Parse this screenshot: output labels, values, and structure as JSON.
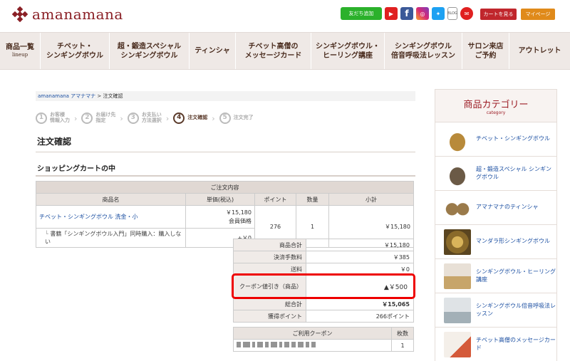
{
  "header": {
    "logo_text": "amanamana",
    "line_label": "友だち追加",
    "blog_label": "BLOG",
    "cart_label": "カートを見る",
    "mypage_label": "マイページ"
  },
  "nav": {
    "items": [
      {
        "label": "商品一覧",
        "sub": "lineup"
      },
      {
        "label": "チベット・",
        "label2": "シンギングボウル"
      },
      {
        "label": "超・鍛造スペシャル",
        "label2": "シンギングボウル"
      },
      {
        "label": "ティンシャ",
        "label2": ""
      },
      {
        "label": "チベット高僧の",
        "label2": "メッセージカード"
      },
      {
        "label": "シンギングボウル・",
        "label2": "ヒーリング講座"
      },
      {
        "label": "シンギングボウル",
        "label2": "倍音呼吸法レッスン"
      },
      {
        "label": "サロン来店",
        "label2": "ご予約"
      },
      {
        "label": "アウトレット",
        "label2": ""
      }
    ]
  },
  "breadcrumb": {
    "link": "amanamana アマナマナ",
    "current": " > 注文確認"
  },
  "steps": [
    {
      "num": "1",
      "line1": "お客様",
      "line2": "情報入力"
    },
    {
      "num": "2",
      "line1": "お届け先",
      "line2": "指定"
    },
    {
      "num": "3",
      "line1": "お支払い",
      "line2": "方法選択"
    },
    {
      "num": "4",
      "line1": "注文確認",
      "line2": ""
    },
    {
      "num": "5",
      "line1": "注文完了",
      "line2": ""
    }
  ],
  "page_title": "注文確認",
  "section_title": "ショッピングカートの中",
  "cart": {
    "caption": "ご注文内容",
    "headers": [
      "商品名",
      "単価(税込)",
      "ポイント",
      "数量",
      "小計"
    ],
    "item": {
      "name": "チベット・シンギングボウル 洗金・小",
      "price": "￥15,180",
      "member_price": "会員価格",
      "points": "276",
      "qty": "1",
      "subtotal": "￥15,180"
    },
    "option": {
      "label": "書籍「シンギングボウル入門」同時購入：購入しない",
      "price": "+￥0"
    }
  },
  "summary": [
    {
      "label": "商品合計",
      "value": "￥15,180"
    },
    {
      "label": "決済手数料",
      "value": "￥385"
    },
    {
      "label": "送料",
      "value": "￥0"
    },
    {
      "label": "クーポン値引き（商品）",
      "value": "▲￥500"
    },
    {
      "label": "総合計",
      "value": "￥15,065"
    },
    {
      "label": "獲得ポイント",
      "value": "266ポイント"
    }
  ],
  "coupon": {
    "header": "ご利用クーポン",
    "count_header": "枚数",
    "count": "1"
  },
  "sidebar": {
    "title": "商品カテゴリー",
    "sub": "category",
    "items": [
      {
        "label": "チベット・シンギングボウル"
      },
      {
        "label": "超・鍛造スペシャル シンギングボウル"
      },
      {
        "label": "アマナマナのティンシャ"
      },
      {
        "label": "マンダラ形シンギングボウル"
      },
      {
        "label": "シンギングボウル・ヒーリング講座"
      },
      {
        "label": "シンギングボウル倍音呼吸法レッスン"
      },
      {
        "label": "チベット高僧のメッセージカード"
      }
    ]
  }
}
